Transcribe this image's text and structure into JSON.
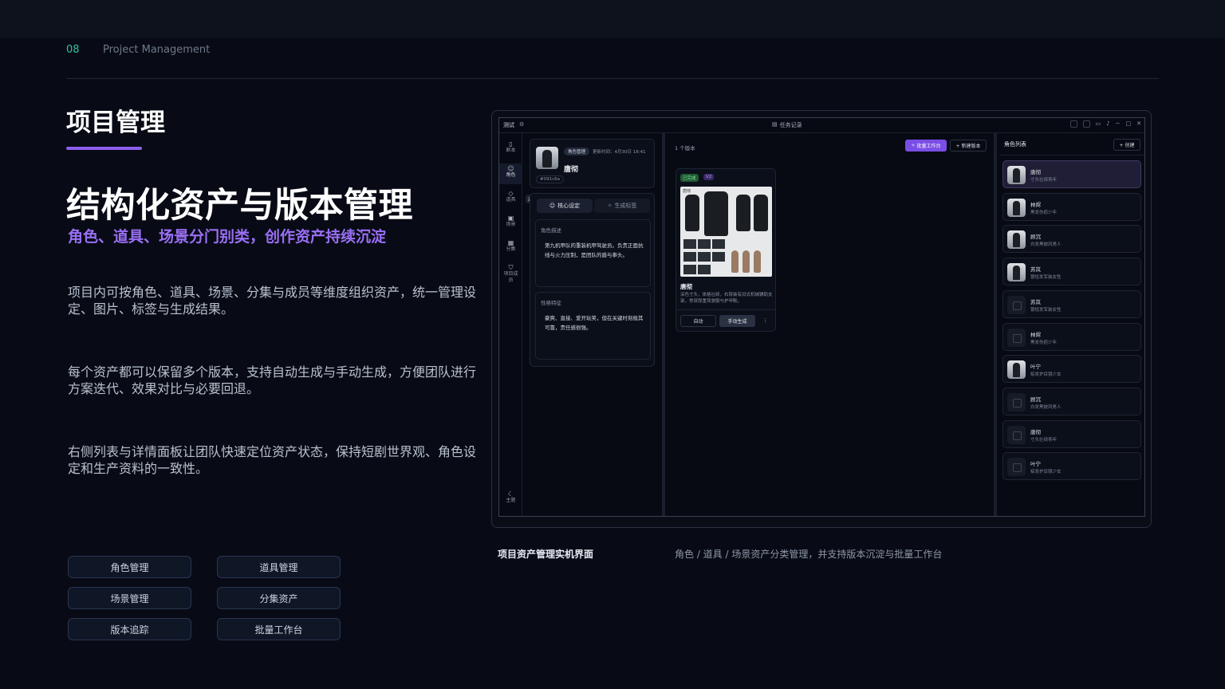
{
  "header": {
    "page_number": "08",
    "section": "Project Management"
  },
  "title": "项目管理",
  "headline": "结构化资产与版本管理",
  "subheadline": "角色、道具、场景分门别类，创作资产持续沉淀",
  "paragraphs": [
    "项目内可按角色、道具、场景、分集与成员等维度组织资产，统一管理设定、图片、标签与生成结果。",
    "每个资产都可以保留多个版本，支持自动生成与手动生成，方便团队进行方案迭代、效果对比与必要回退。",
    "右侧列表与详情面板让团队快速定位资产状态，保持短剧世界观、角色设定和生产资料的一致性。"
  ],
  "tags": [
    "角色管理",
    "道具管理",
    "场景管理",
    "分集资产",
    "版本追踪",
    "批量工作台"
  ],
  "caption": {
    "title": "项目资产管理实机界面",
    "description": "角色 / 道具 / 场景资产分类管理，并支持版本沉淀与批量工作台"
  },
  "app": {
    "project_name": "测试",
    "center_title": "任务记录",
    "sidebar": [
      {
        "icon": "document-icon",
        "label": "剧本"
      },
      {
        "icon": "user-icon",
        "label": "角色"
      },
      {
        "icon": "box-icon",
        "label": "道具"
      },
      {
        "icon": "image-icon",
        "label": "场景"
      },
      {
        "icon": "film-icon",
        "label": "分集"
      },
      {
        "icon": "shield-icon",
        "label": "项目成员"
      }
    ],
    "sidebar_bottom": {
      "icon": "moon-icon",
      "label": "主题"
    },
    "tooltip": "道具",
    "detail": {
      "badge": "角色管理",
      "updated": "更新时间：4月30日 18:41",
      "name": "唐彻",
      "id": "#091c6a",
      "tab_core": "核心设定",
      "tab_gen": "生成标签",
      "role_desc_title": "角色描述",
      "role_desc": "第九机甲队的重装机甲驾驶员。负责正面抗线与火力压制，是团队的盾与拳头。",
      "traits_title": "性格特征",
      "traits": "豪爽、直接、爱开玩笑，但在关键时刻极其可靠，责任感很强。"
    },
    "main": {
      "version_count": "1 个版本",
      "batch_button": "批量工作台",
      "new_version_button": "+ 新建版本",
      "status_badge": "已完成",
      "version_badge": "V2",
      "thumb_label": "唐彻",
      "card_name": "唐彻",
      "card_desc": "深色寸头，体格壮硕，右臂装有旧式机械辅助支架，常穿厚重驾驶服与护甲靴。",
      "auto_button": "自动",
      "manual_button": "手动生成",
      "more": "⋮"
    },
    "right": {
      "title": "角色列表",
      "create_button": "+ 创建",
      "items": [
        {
          "name": "唐彻",
          "desc": "寸头壮硕青年",
          "thumb": "image"
        },
        {
          "name": "林烬",
          "desc": "黑发伤疤少年",
          "thumb": "image"
        },
        {
          "name": "顾沉",
          "desc": "白发黑披风男人",
          "thumb": "image"
        },
        {
          "name": "苏岚",
          "desc": "银短发军装女性",
          "thumb": "image"
        },
        {
          "name": "苏岚",
          "desc": "银短发军装女性",
          "thumb": "placeholder"
        },
        {
          "name": "林烬",
          "desc": "黑发伤疤少年",
          "thumb": "placeholder"
        },
        {
          "name": "叶宁",
          "desc": "棕发护目镜少女",
          "thumb": "image"
        },
        {
          "name": "顾沉",
          "desc": "白发黑披风男人",
          "thumb": "placeholder"
        },
        {
          "name": "唐彻",
          "desc": "寸头壮硕青年",
          "thumb": "placeholder"
        },
        {
          "name": "叶宁",
          "desc": "棕发护目镜少女",
          "thumb": "placeholder"
        }
      ]
    }
  },
  "colors": {
    "accent": "#8c5ff0",
    "page_number": "#2fc59a",
    "background": "#080b15",
    "success": "#3aa35a"
  }
}
